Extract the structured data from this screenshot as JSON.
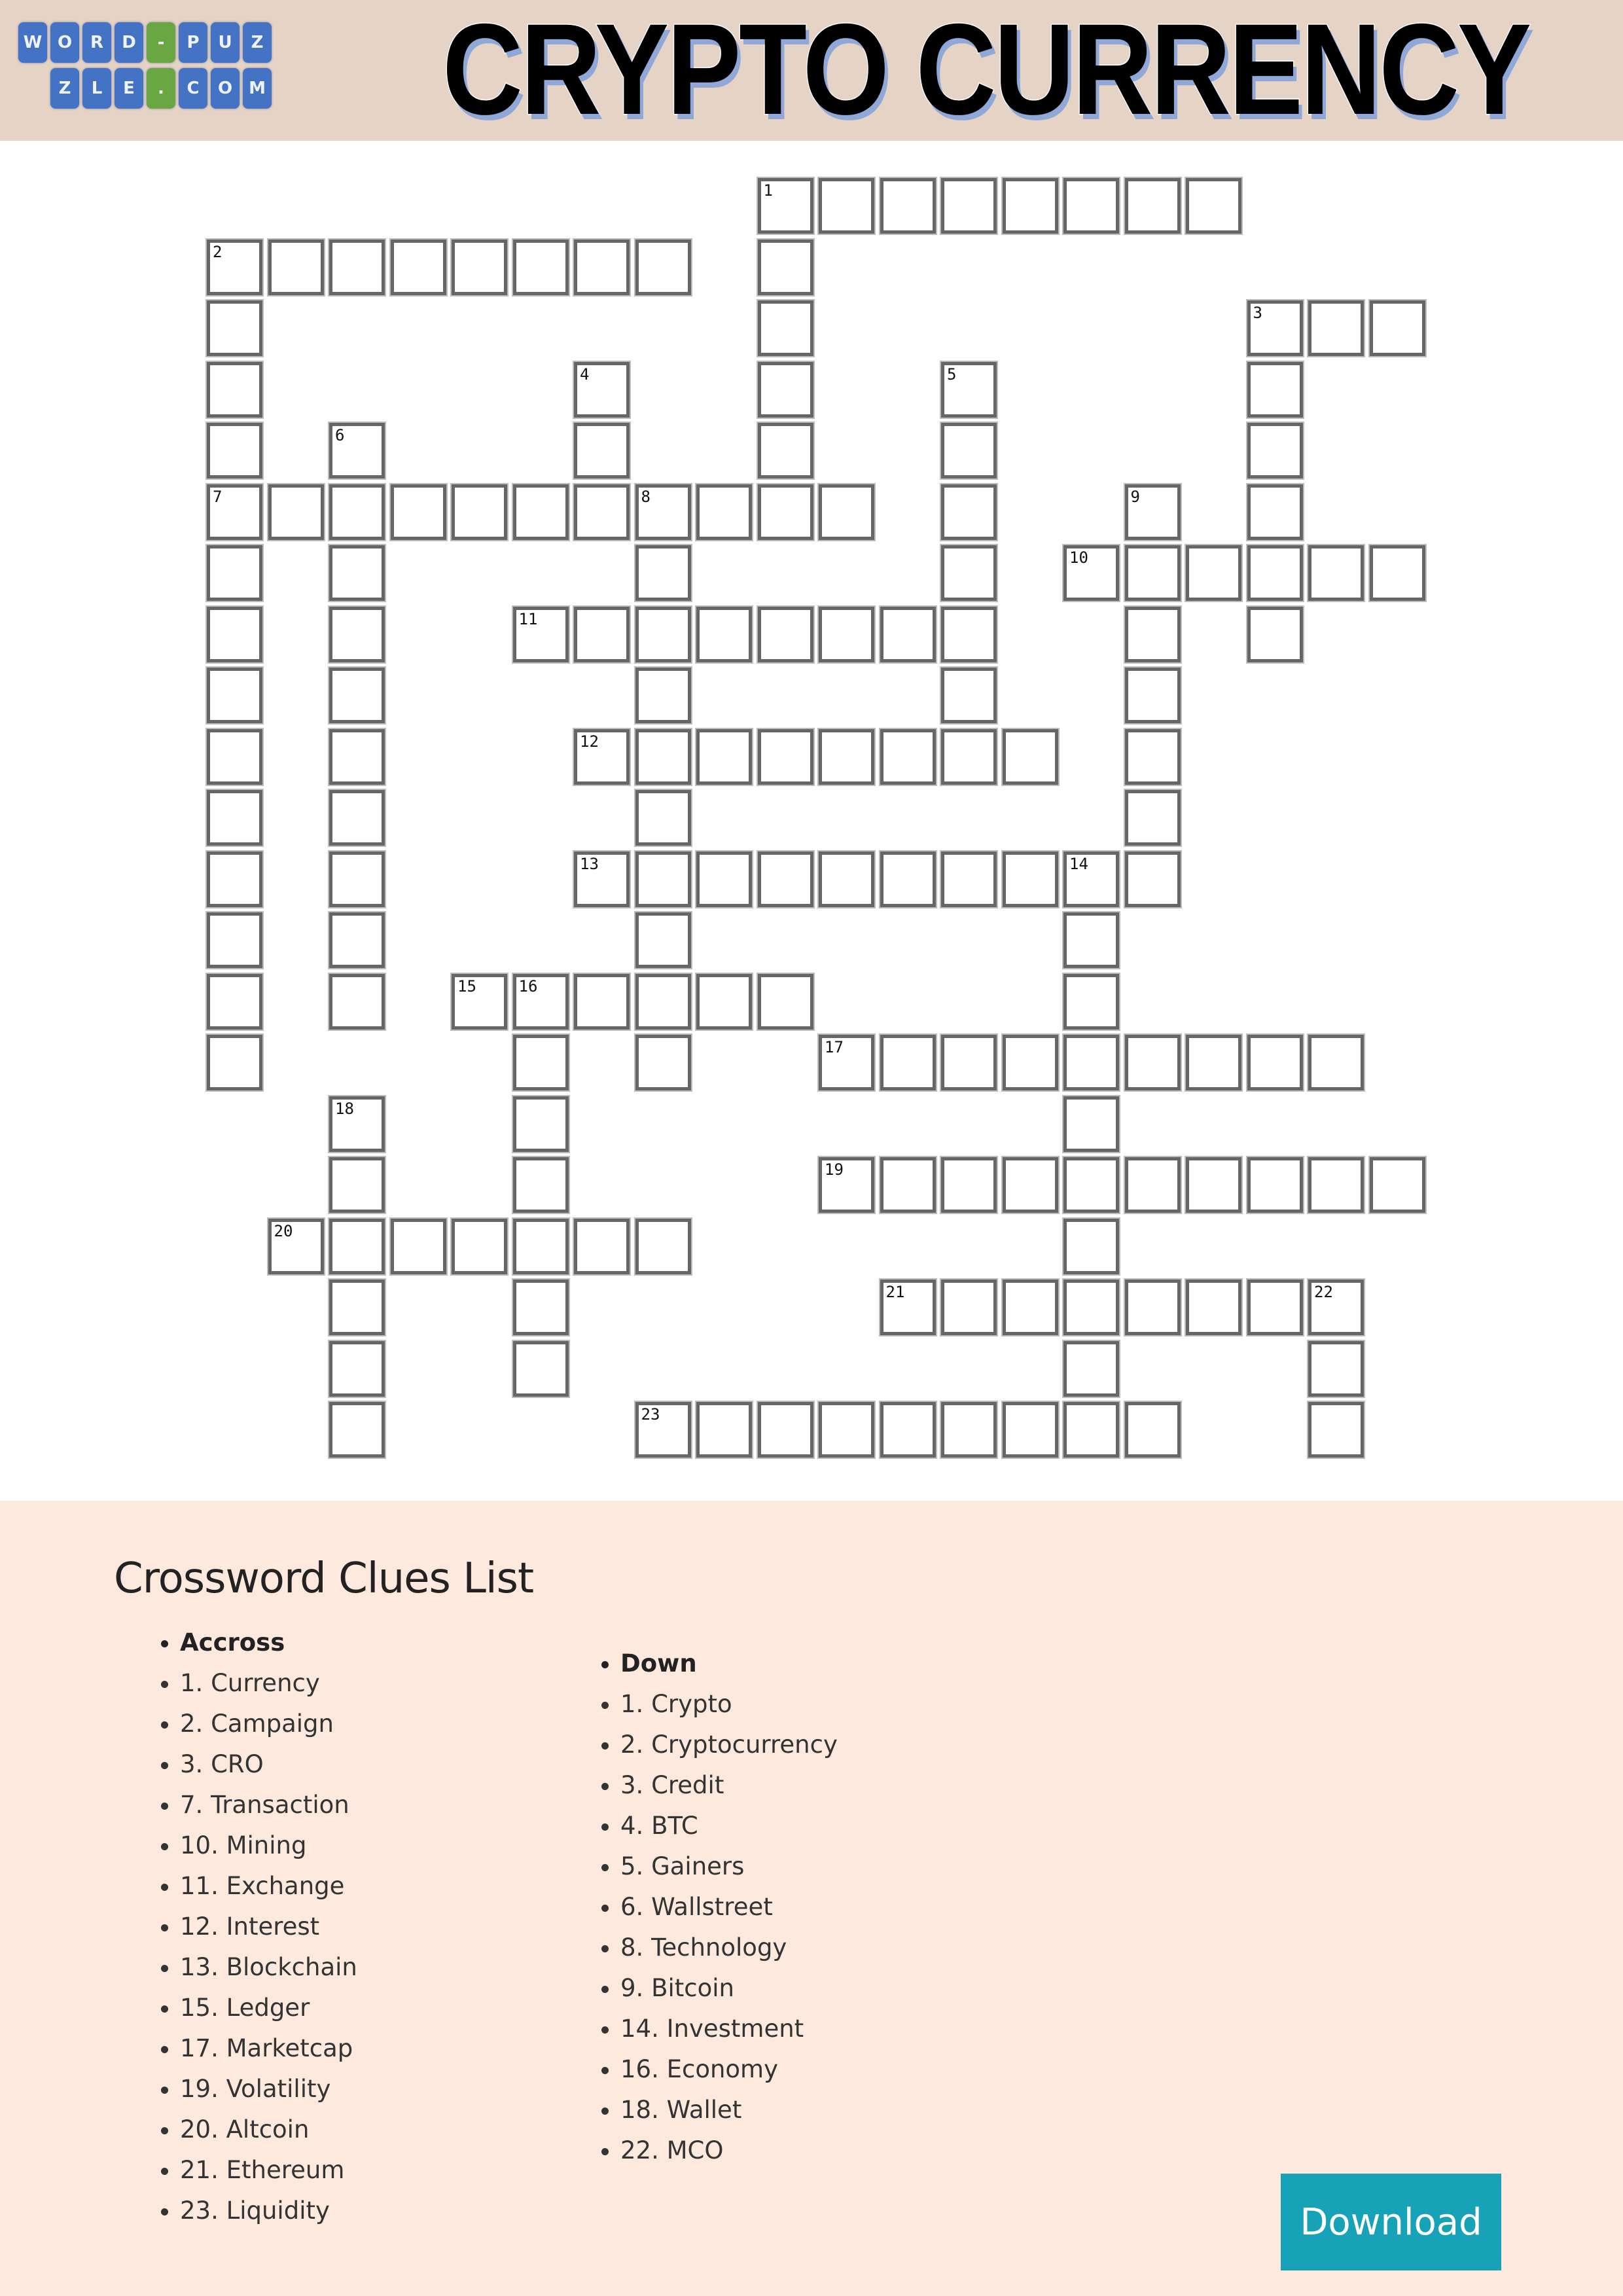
{
  "header": {
    "logo_row1": [
      "W",
      "O",
      "R",
      "D",
      "-",
      "P",
      "U",
      "Z"
    ],
    "logo_row2": [
      "Z",
      "L",
      "E",
      ".",
      "C",
      "O",
      "M"
    ],
    "title": "CRYPTO CURRENCY"
  },
  "colors": {
    "header_bg": "#e5d3c5",
    "logo_tile": "#4472c4",
    "logo_tile_accent": "#6aa642",
    "clues_bg": "#fde9dd",
    "download_bg": "#17a2b8",
    "cell_border": "#666666"
  },
  "puzzle": {
    "rows": 21,
    "cols": 20,
    "words": [
      {
        "num": 1,
        "dir": "across",
        "col": 9,
        "row": 0,
        "len": 8
      },
      {
        "num": 1,
        "dir": "down",
        "col": 9,
        "row": 0,
        "len": 6
      },
      {
        "num": 2,
        "dir": "across",
        "col": 0,
        "row": 1,
        "len": 8
      },
      {
        "num": 2,
        "dir": "down",
        "col": 0,
        "row": 1,
        "len": 14
      },
      {
        "num": 3,
        "dir": "across",
        "col": 17,
        "row": 2,
        "len": 3
      },
      {
        "num": 3,
        "dir": "down",
        "col": 17,
        "row": 2,
        "len": 6
      },
      {
        "num": 4,
        "dir": "down",
        "col": 6,
        "row": 3,
        "len": 3
      },
      {
        "num": 5,
        "dir": "down",
        "col": 12,
        "row": 3,
        "len": 7
      },
      {
        "num": 6,
        "dir": "down",
        "col": 2,
        "row": 4,
        "len": 10
      },
      {
        "num": 7,
        "dir": "across",
        "col": 0,
        "row": 5,
        "len": 11
      },
      {
        "num": 8,
        "dir": "down",
        "col": 7,
        "row": 5,
        "len": 10
      },
      {
        "num": 9,
        "dir": "down",
        "col": 15,
        "row": 5,
        "len": 7
      },
      {
        "num": 10,
        "dir": "across",
        "col": 14,
        "row": 6,
        "len": 6
      },
      {
        "num": 11,
        "dir": "across",
        "col": 5,
        "row": 7,
        "len": 8
      },
      {
        "num": 12,
        "dir": "across",
        "col": 6,
        "row": 9,
        "len": 8
      },
      {
        "num": 13,
        "dir": "across",
        "col": 6,
        "row": 11,
        "len": 10
      },
      {
        "num": 14,
        "dir": "down",
        "col": 14,
        "row": 11,
        "len": 10
      },
      {
        "num": 15,
        "dir": "across",
        "col": 4,
        "row": 13,
        "len": 6
      },
      {
        "num": 16,
        "dir": "down",
        "col": 5,
        "row": 13,
        "len": 7
      },
      {
        "num": 17,
        "dir": "across",
        "col": 10,
        "row": 14,
        "len": 9
      },
      {
        "num": 18,
        "dir": "down",
        "col": 2,
        "row": 15,
        "len": 6
      },
      {
        "num": 19,
        "dir": "across",
        "col": 10,
        "row": 16,
        "len": 10
      },
      {
        "num": 20,
        "dir": "across",
        "col": 1,
        "row": 17,
        "len": 7
      },
      {
        "num": 21,
        "dir": "across",
        "col": 11,
        "row": 18,
        "len": 8
      },
      {
        "num": 22,
        "dir": "down",
        "col": 18,
        "row": 18,
        "len": 3
      },
      {
        "num": 23,
        "dir": "across",
        "col": 7,
        "row": 20,
        "len": 9
      }
    ]
  },
  "clues": {
    "title": "Crossword Clues List",
    "across_heading": "Accross",
    "across": [
      "1. Currency",
      "2. Campaign",
      "3. CRO",
      "7. Transaction",
      "10. Mining",
      "11. Exchange",
      "12. Interest",
      "13. Blockchain",
      "15. Ledger",
      "17. Marketcap",
      "19. Volatility",
      "20. Altcoin",
      "21. Ethereum",
      "23. Liquidity"
    ],
    "down_heading": "Down",
    "down": [
      "1. Crypto",
      "2. Cryptocurrency",
      "3. Credit",
      "4. BTC",
      "5. Gainers",
      "6. Wallstreet",
      "8. Technology",
      "9. Bitcoin",
      "14. Investment",
      "16. Economy",
      "18. Wallet",
      "22. MCO"
    ]
  },
  "download_label": "Download"
}
